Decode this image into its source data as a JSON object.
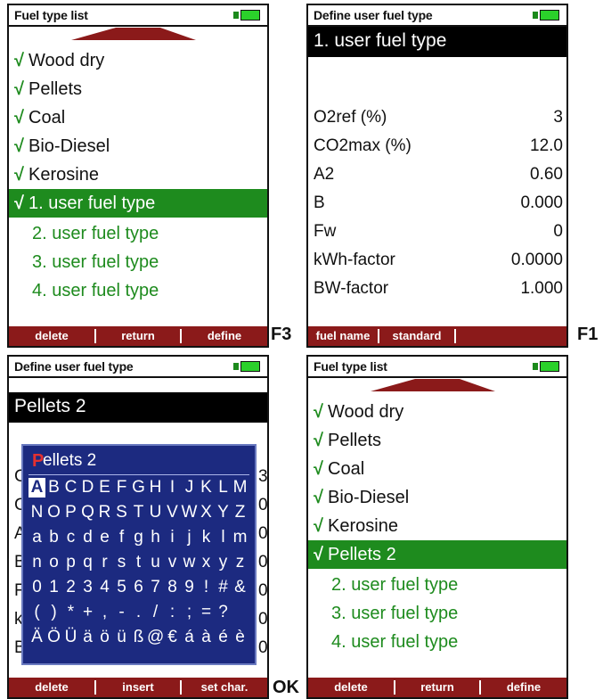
{
  "screen1": {
    "title": "Fuel type list",
    "items": [
      {
        "check": "√",
        "label": "Wood dry"
      },
      {
        "check": "√",
        "label": "Pellets"
      },
      {
        "check": "√",
        "label": "Coal"
      },
      {
        "check": "√",
        "label": "Bio-Diesel"
      },
      {
        "check": "√",
        "label": "Kerosine"
      },
      {
        "check": "√",
        "label": "1. user fuel type"
      },
      {
        "check": "",
        "label": "2. user fuel type"
      },
      {
        "check": "",
        "label": "3. user fuel type"
      },
      {
        "check": "",
        "label": "4. user fuel type"
      }
    ],
    "softkeys": [
      "delete",
      "return",
      "define"
    ],
    "fkey": "F3"
  },
  "screen2": {
    "title": "Define user fuel type",
    "header_value": "1. user fuel type",
    "params": [
      {
        "name": "O2ref (%)",
        "value": "3"
      },
      {
        "name": "CO2max (%)",
        "value": "12.0"
      },
      {
        "name": "A2",
        "value": "0.60"
      },
      {
        "name": "B",
        "value": "0.000"
      },
      {
        "name": "Fw",
        "value": "0"
      },
      {
        "name": "kWh-factor",
        "value": "0.0000"
      },
      {
        "name": "BW-factor",
        "value": "1.000"
      }
    ],
    "softkeys": [
      "fuel name",
      "standard",
      ""
    ],
    "fkey": "F1"
  },
  "screen3": {
    "title": "Define user fuel type",
    "header_value": "Pellets 2",
    "input_first": "P",
    "input_rest": "ellets 2",
    "keyboard_rows": [
      [
        "A",
        "B",
        "C",
        "D",
        "E",
        "F",
        "G",
        "H",
        "I",
        "J",
        "K",
        "L",
        "M"
      ],
      [
        "N",
        "O",
        "P",
        "Q",
        "R",
        "S",
        "T",
        "U",
        "V",
        "W",
        "X",
        "Y",
        "Z"
      ],
      [
        "a",
        "b",
        "c",
        "d",
        "e",
        "f",
        "g",
        "h",
        "i",
        "j",
        "k",
        "l",
        "m"
      ],
      [
        "n",
        "o",
        "p",
        "q",
        "r",
        "s",
        "t",
        "u",
        "v",
        "w",
        "x",
        "y",
        "z"
      ],
      [
        "0",
        "1",
        "2",
        "3",
        "4",
        "5",
        "6",
        "7",
        "8",
        "9",
        "!",
        "#",
        "&"
      ],
      [
        "(",
        ")",
        "*",
        "+",
        ",",
        "-",
        ".",
        "/",
        ":",
        ";",
        "=",
        "?",
        ""
      ],
      [
        "Ä",
        "Ö",
        "Ü",
        "ä",
        "ö",
        "ü",
        "ß",
        "@",
        "€",
        "á",
        "à",
        "é",
        "è"
      ]
    ],
    "softkeys": [
      "delete",
      "insert",
      "set char."
    ],
    "fkey": "OK"
  },
  "screen4": {
    "title": "Fuel type list",
    "items": [
      {
        "check": "√",
        "label": "Wood dry"
      },
      {
        "check": "√",
        "label": "Pellets"
      },
      {
        "check": "√",
        "label": "Coal"
      },
      {
        "check": "√",
        "label": "Bio-Diesel"
      },
      {
        "check": "√",
        "label": "Kerosine"
      },
      {
        "check": "√",
        "label": "Pellets 2"
      },
      {
        "check": "",
        "label": "2. user fuel type"
      },
      {
        "check": "",
        "label": "3. user fuel type"
      },
      {
        "check": "",
        "label": "4. user fuel type"
      }
    ],
    "softkeys": [
      "delete",
      "return",
      "define"
    ]
  },
  "colors": {
    "accent_green": "#1e8b1e",
    "softkey_red": "#8b1a1a",
    "keyboard_blue": "#1c2a80"
  }
}
